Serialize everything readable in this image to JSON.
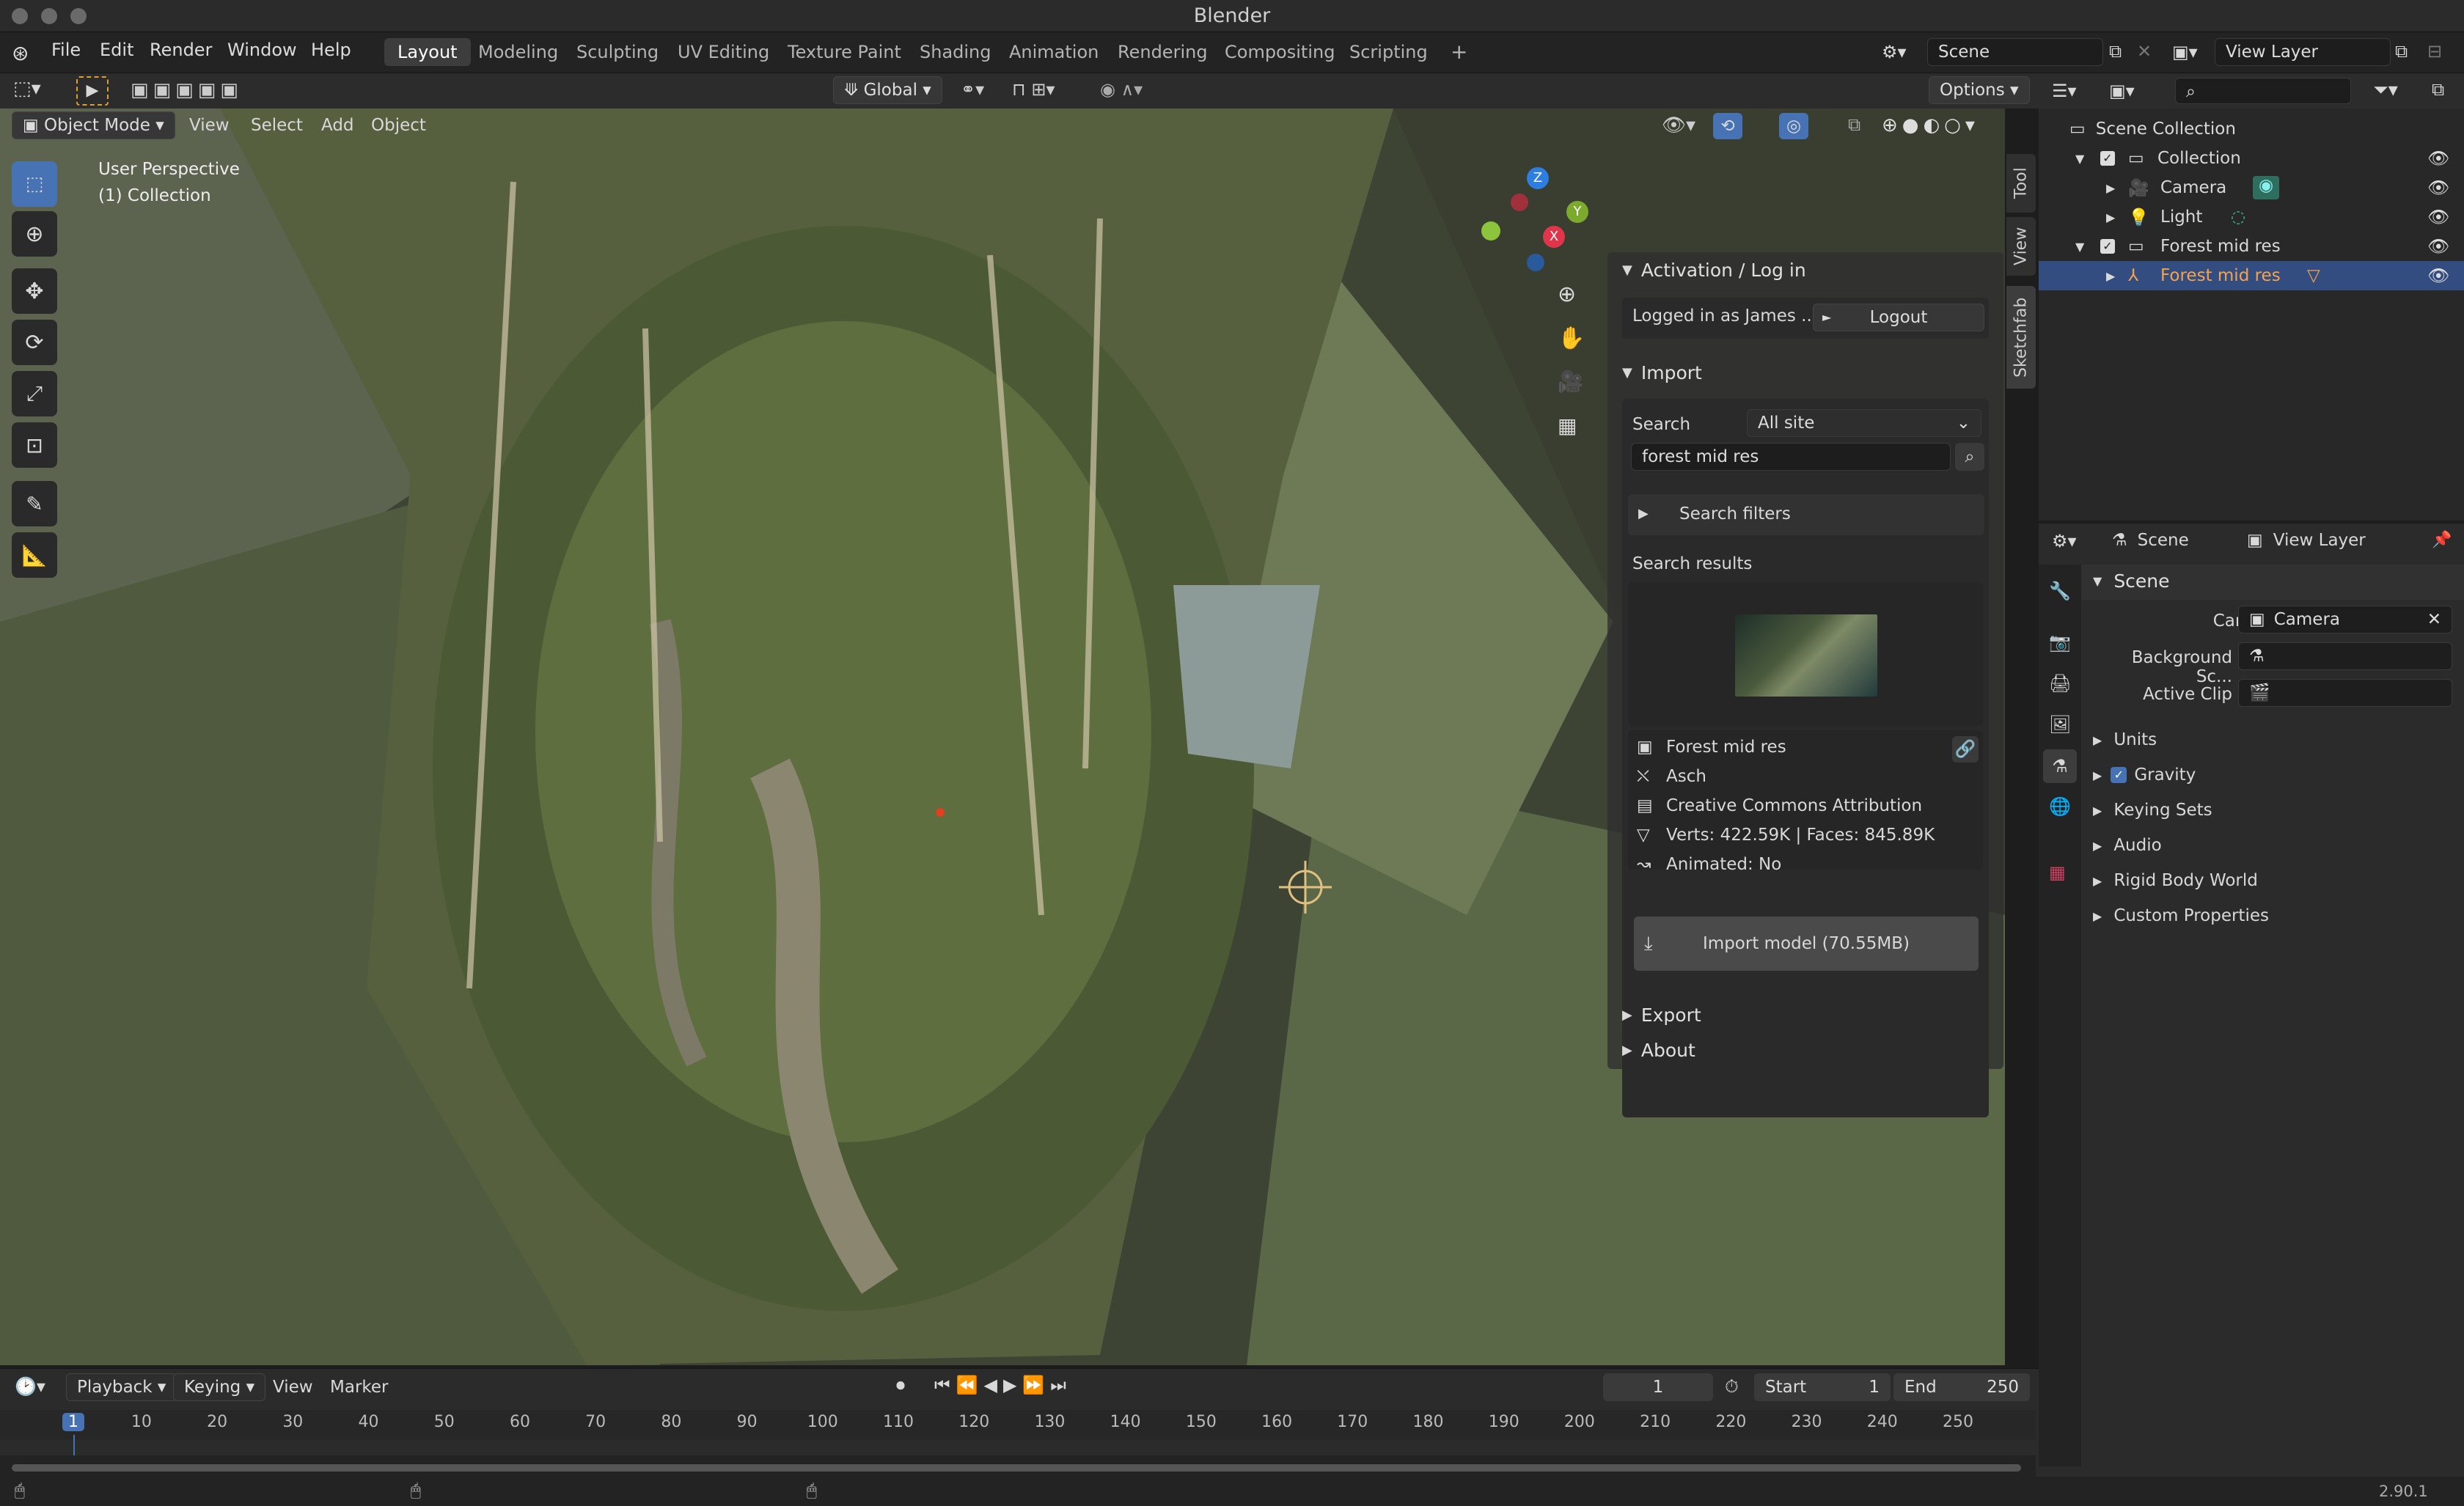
{
  "window": {
    "title": "Blender"
  },
  "menu": [
    "File",
    "Edit",
    "Render",
    "Window",
    "Help"
  ],
  "workspaces": [
    {
      "label": "Layout",
      "active": true
    },
    {
      "label": "Modeling"
    },
    {
      "label": "Sculpting"
    },
    {
      "label": "UV Editing"
    },
    {
      "label": "Texture Paint"
    },
    {
      "label": "Shading"
    },
    {
      "label": "Animation"
    },
    {
      "label": "Rendering"
    },
    {
      "label": "Compositing"
    },
    {
      "label": "Scripting"
    }
  ],
  "scene_field": "Scene",
  "view_layer_field": "View Layer",
  "viewport_header": {
    "mode": "Object Mode",
    "items": [
      "View",
      "Select",
      "Add",
      "Object"
    ],
    "transform": "Global",
    "options": "Options"
  },
  "viewport": {
    "perspective": "User Perspective",
    "collection": "(1) Collection",
    "gizmo": {
      "x": "X",
      "y": "Y",
      "z": "Z"
    }
  },
  "sidebar_tabs": [
    "Tool",
    "View",
    "Sketchfab"
  ],
  "sketchfab": {
    "activation_header": "Activation / Log in",
    "logged_in": "Logged in as James ...",
    "logout": "Logout",
    "import_header": "Import",
    "search_label": "Search",
    "search_scope": "All site",
    "search_value": "forest mid res",
    "search_filters": "Search filters",
    "results_label": "Search results",
    "model": {
      "name": "Forest mid res",
      "author": "Asch",
      "license": "Creative Commons Attribution",
      "stats": "Verts: 422.59K  |  Faces: 845.89K",
      "animated": "Animated: No"
    },
    "import_button": "Import model (70.55MB)",
    "export_header": "Export",
    "about_header": "About"
  },
  "outliner": {
    "root": "Scene Collection",
    "items": [
      {
        "label": "Collection",
        "indent": 0,
        "type": "collection"
      },
      {
        "label": "Camera",
        "indent": 1,
        "type": "camera"
      },
      {
        "label": "Light",
        "indent": 1,
        "type": "light"
      },
      {
        "label": "Forest mid res",
        "indent": 0,
        "type": "collection"
      },
      {
        "label": "Forest mid res",
        "indent": 1,
        "type": "object",
        "selected": true
      }
    ]
  },
  "properties": {
    "tabs": [
      "Scene",
      "View Layer"
    ],
    "section": "Scene",
    "camera_label": "Camera",
    "camera_value": "Camera",
    "bg_label": "Background Sc...",
    "clip_label": "Active Clip",
    "subsections": [
      "Units",
      "Gravity",
      "Keying Sets",
      "Audio",
      "Rigid Body World",
      "Custom Properties"
    ]
  },
  "timeline": {
    "menus": [
      "Playback",
      "Keying",
      "View",
      "Marker"
    ],
    "current_frame": "1",
    "start_label": "Start",
    "start": "1",
    "end_label": "End",
    "end": "250",
    "ticks": [
      "1",
      "10",
      "20",
      "30",
      "40",
      "50",
      "60",
      "70",
      "80",
      "90",
      "100",
      "110",
      "120",
      "130",
      "140",
      "150",
      "160",
      "170",
      "180",
      "190",
      "200",
      "210",
      "220",
      "230",
      "240",
      "250"
    ]
  },
  "version": "2.90.1",
  "colors": {
    "accent": "#4772b3",
    "selected_text": "#f5a34b",
    "bg": "#1d1d1d"
  }
}
